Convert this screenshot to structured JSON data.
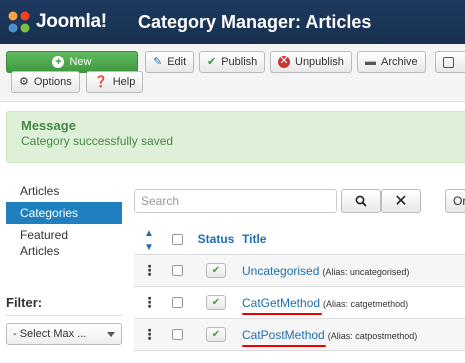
{
  "header": {
    "brand": "Joomla!",
    "page_title": "Category Manager: Articles"
  },
  "toolbar": {
    "new": "New",
    "edit": "Edit",
    "publish": "Publish",
    "unpublish": "Unpublish",
    "archive": "Archive",
    "options": "Options",
    "help": "Help"
  },
  "message": {
    "heading": "Message",
    "text": "Category successfully saved"
  },
  "sidebar": {
    "items": [
      {
        "label": "Articles",
        "active": false
      },
      {
        "label": "Categories",
        "active": true
      },
      {
        "label": "Featured Articles",
        "active": false
      }
    ],
    "filter_label": "Filter:",
    "select_max": "- Select Max ..."
  },
  "search": {
    "placeholder": "Search",
    "more_label": "Or"
  },
  "table": {
    "headers": {
      "status": "Status",
      "title": "Title"
    },
    "rows": [
      {
        "title": "Uncategorised",
        "alias": "(Alias: uncategorised)",
        "status": "published"
      },
      {
        "title": "CatGetMethod",
        "alias": "(Alias: catgetmethod)",
        "status": "published"
      },
      {
        "title": "CatPostMethod",
        "alias": "(Alias: catpostmethod)",
        "status": "published"
      }
    ]
  },
  "colors": {
    "header_bg": "#1f3a60",
    "accent": "#1f7fbf",
    "success": "#468847",
    "annotation": "#e00000"
  }
}
